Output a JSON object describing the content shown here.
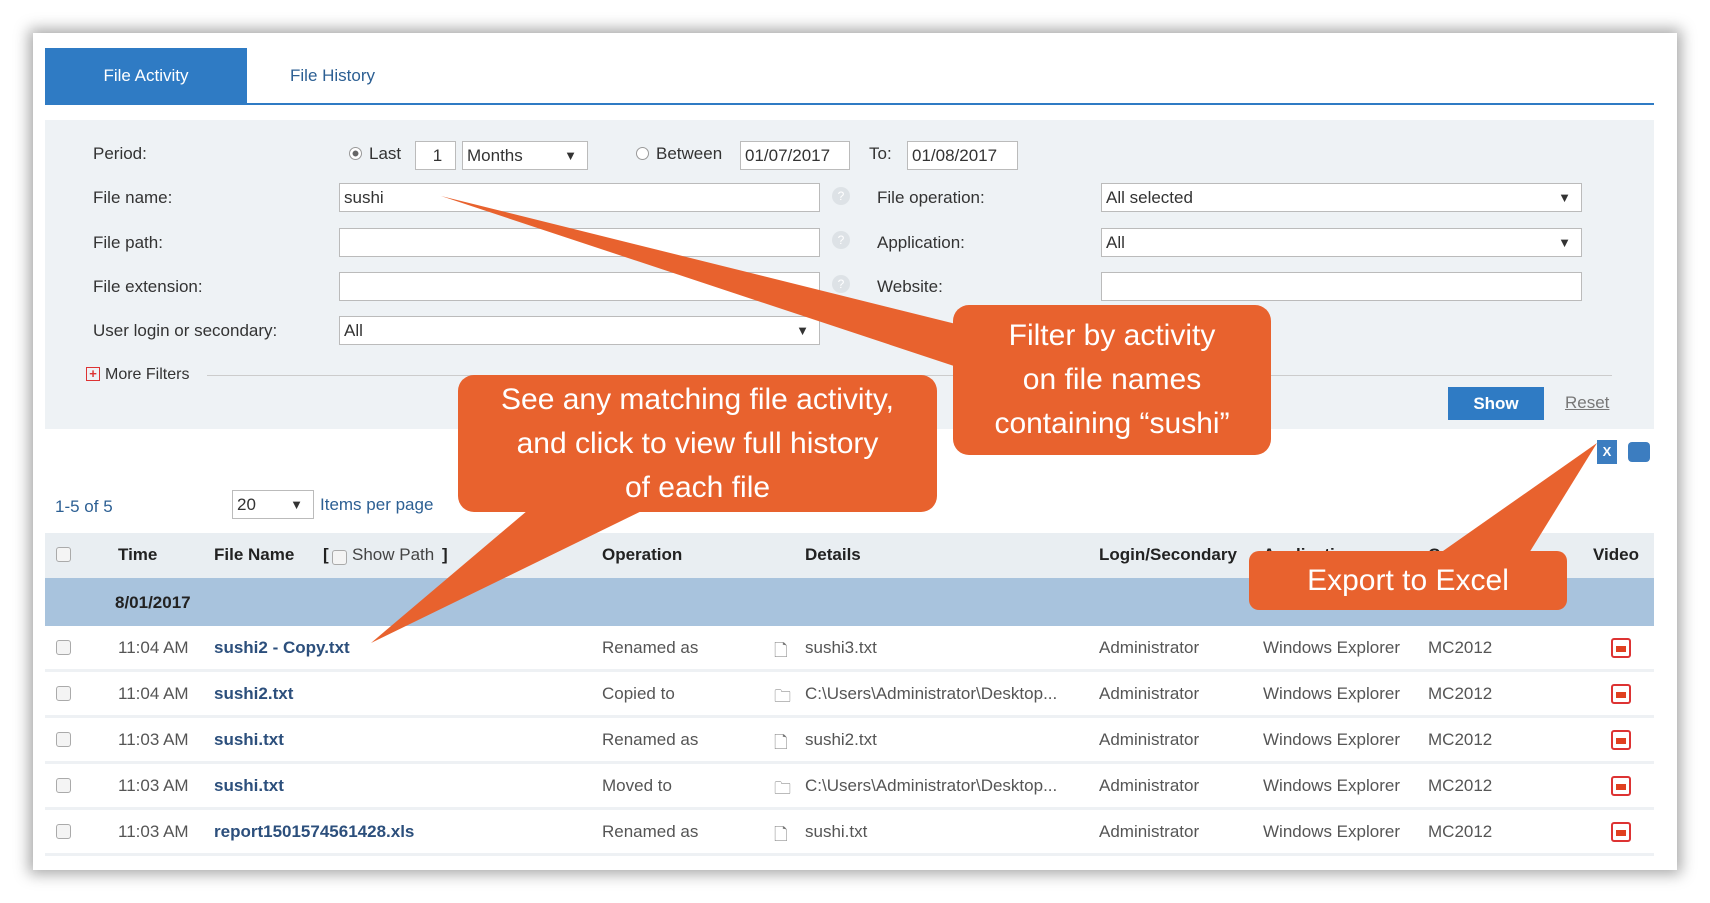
{
  "tabs": [
    {
      "label": "File Activity",
      "active": true
    },
    {
      "label": "File History",
      "active": false
    }
  ],
  "filters": {
    "period_label": "Period:",
    "last_label": "Last",
    "last_value": "1",
    "unit_value": "Months",
    "between_label": "Between",
    "from_date": "01/07/2017",
    "to_label": "To:",
    "to_date": "01/08/2017",
    "period_mode": "Last",
    "file_name_label": "File name:",
    "file_name_value": "sushi",
    "file_path_label": "File path:",
    "file_path_value": "",
    "file_ext_label": "File extension:",
    "file_ext_value": "",
    "user_login_label": "User login or secondary:",
    "user_login_value": "All",
    "file_op_label": "File operation:",
    "file_op_value": "All selected",
    "application_label": "Application:",
    "application_value": "All",
    "website_label": "Website:",
    "website_value": "",
    "more_filters": "More Filters",
    "show": "Show",
    "reset": "Reset"
  },
  "pager": {
    "range": "1-5 of 5",
    "per_page": "20",
    "per_page_label": "Items per page"
  },
  "table": {
    "headers": {
      "time": "Time",
      "file_name": "File Name",
      "show_path_open": "[",
      "show_path": "Show Path",
      "show_path_close": "]",
      "operation": "Operation",
      "details": "Details",
      "login": "Login/Secondary",
      "application": "Application",
      "computer": "Computer",
      "video": "Video"
    },
    "group": "8/01/2017",
    "rows": [
      {
        "time": "11:04 AM",
        "file": "sushi2 - Copy.txt",
        "operation": "Renamed as",
        "details_icon": "file-icon",
        "details": "sushi3.txt",
        "login": "Administrator",
        "application": "Windows Explorer",
        "computer": "MC2012"
      },
      {
        "time": "11:04 AM",
        "file": "sushi2.txt",
        "operation": "Copied to",
        "details_icon": "folder-icon",
        "details": "C:\\Users\\Administrator\\Desktop...",
        "login": "Administrator",
        "application": "Windows Explorer",
        "computer": "MC2012"
      },
      {
        "time": "11:03 AM",
        "file": "sushi.txt",
        "operation": "Renamed as",
        "details_icon": "file-icon",
        "details": "sushi2.txt",
        "login": "Administrator",
        "application": "Windows Explorer",
        "computer": "MC2012"
      },
      {
        "time": "11:03 AM",
        "file": "sushi.txt",
        "operation": "Moved to",
        "details_icon": "folder-icon",
        "details": "C:\\Users\\Administrator\\Desktop...",
        "login": "Administrator",
        "application": "Windows Explorer",
        "computer": "MC2012"
      },
      {
        "time": "11:03 AM",
        "file": "report1501574561428.xls",
        "operation": "Renamed as",
        "details_icon": "file-icon",
        "details": "sushi.txt",
        "login": "Administrator",
        "application": "Windows Explorer",
        "computer": "MC2012"
      }
    ]
  },
  "callouts": {
    "filter": [
      "Filter by activity",
      "on file names",
      "containing “sushi”"
    ],
    "matching": [
      "See any matching file activity,",
      "and click to view full history",
      "of each file"
    ],
    "export": "Export to Excel"
  },
  "colors": {
    "accent": "#2f7bc4",
    "callout": "#e8622e",
    "group_row": "#a8c3dd"
  }
}
